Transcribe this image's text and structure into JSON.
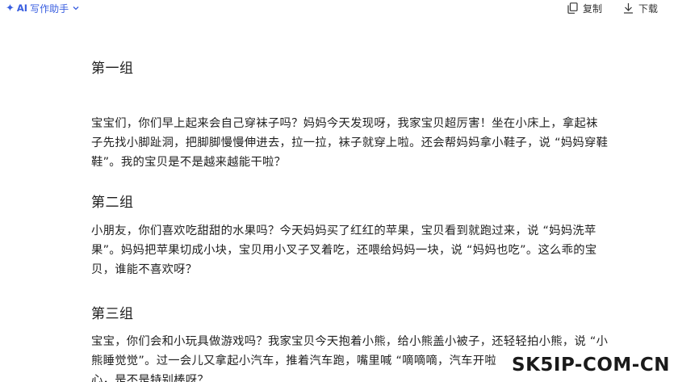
{
  "toolbar": {
    "ai_tag": "AI",
    "ai_label": "写作助手",
    "copy_label": "复制",
    "download_label": "下载",
    "icons": [
      "sparkle-icon",
      "chevron-down-icon",
      "copy-icon",
      "download-icon"
    ],
    "accent": "#3a5fe0"
  },
  "doc": {
    "sections": [
      {
        "heading": "第一组",
        "lines": [
          "宝宝们，你们早上起来会自己穿袜子吗？妈妈今天发现呀，我家宝贝超厉害！坐在小床上，拿起袜",
          "子先找小脚趾洞，把脚脚慢慢伸进去，拉一拉，袜子就穿上啦。还会帮妈妈拿小鞋子，说 “妈妈穿鞋",
          "鞋”。我的宝贝是不是越来越能干啦？"
        ]
      },
      {
        "heading": "第二组",
        "lines": [
          "小朋友，你们喜欢吃甜甜的水果吗？今天妈妈买了红红的苹果，宝贝看到就跑过来，说 “妈妈洗苹",
          "果”。妈妈把苹果切成小块，宝贝用小叉子叉着吃，还喂给妈妈一块，说 “妈妈也吃”。这么乖的宝",
          "贝，谁能不喜欢呀？"
        ]
      },
      {
        "heading": "第三组",
        "lines": [
          "宝宝，你们会和小玩具做游戏吗？我家宝贝今天抱着小熊，给小熊盖小被子，还轻轻拍小熊，说 “小",
          "熊睡觉觉”。过一会儿又拿起小汽车，推着汽车跑，嘴里喊 “嘀嘀嘀，汽车开啦",
          "心，是不是特别棒呀？"
        ]
      }
    ]
  },
  "watermark": {
    "text": "SK5IP-COM-CN"
  }
}
